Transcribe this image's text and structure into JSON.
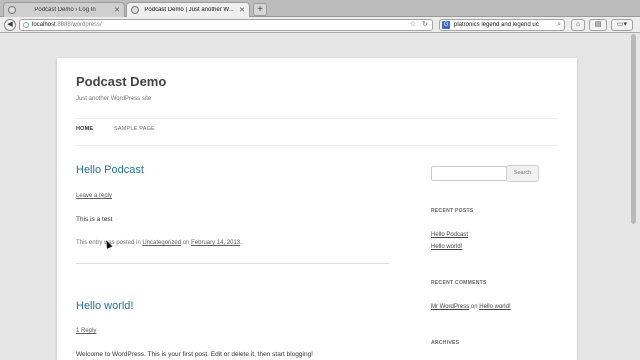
{
  "browser": {
    "tabs": [
      {
        "title": "Podcast Demo › Log In"
      },
      {
        "title": "Podcast Demo | Just another W..."
      }
    ],
    "new_tab": "+",
    "url_host": "localhost",
    "url_rest": ":8888/wordpress/",
    "search_text": "platronics legend and legend uc",
    "search_engine_icon": "G",
    "icons": [
      "back-icon",
      "star-icon",
      "reload-icon",
      "search-engine-icon",
      "magnifier-icon",
      "home-icon",
      "bookmarks-icon",
      "menu-icon"
    ]
  },
  "site": {
    "title": "Podcast Demo",
    "description": "Just another WordPress site",
    "nav": [
      "HOME",
      "SAMPLE PAGE"
    ]
  },
  "posts": [
    {
      "title": "Hello Podcast",
      "comments": "Leave a reply",
      "body": "This is a test",
      "meta_prefix": "This entry was posted in",
      "category": "Uncategorized",
      "meta_on": "on",
      "date": "February 14, 2013",
      "meta_end": "."
    },
    {
      "title": "Hello world!",
      "comments": "1 Reply",
      "body": "Welcome to WordPress. This is your first post. Edit or delete it, then start blogging!"
    }
  ],
  "sidebar": {
    "search_button": "Search",
    "recent_posts_title": "RECENT POSTS",
    "recent_posts": [
      "Hello Podcast",
      "Hello world!"
    ],
    "recent_comments_title": "RECENT COMMENTS",
    "comment_author": "Mr WordPress",
    "comment_on": "on",
    "comment_post": "Hello world!",
    "archives_title": "ARCHIVES"
  }
}
